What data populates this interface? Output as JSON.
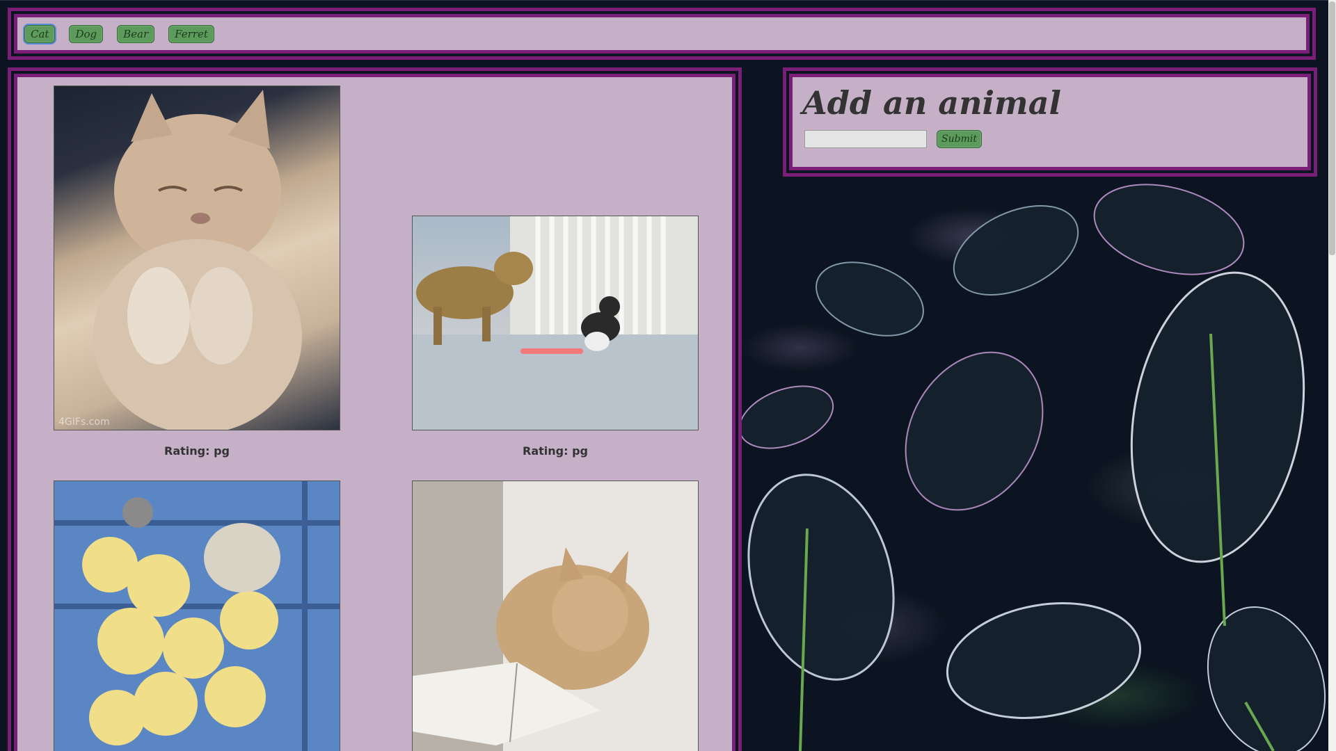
{
  "nav": {
    "buttons": [
      {
        "label": "Cat"
      },
      {
        "label": "Dog"
      },
      {
        "label": "Bear"
      },
      {
        "label": "Ferret"
      }
    ]
  },
  "gallery": {
    "items": [
      {
        "rating": "Rating: pg",
        "icon": "cat-gif-image"
      },
      {
        "rating": "Rating: pg",
        "icon": "dog-and-cat-gif-image"
      },
      {
        "rating": "",
        "icon": "cat-with-chicks-gif-image"
      },
      {
        "rating": "",
        "icon": "cat-with-book-gif-image"
      }
    ],
    "watermark": "4GIFs.com"
  },
  "form": {
    "title": "Add an animal",
    "input_value": "",
    "submit_label": "Submit"
  },
  "colors": {
    "panel_bg": "#c5b0c8",
    "panel_border": "#7a1f78",
    "button_bg": "#5d9b5d",
    "page_bg": "#0b1420"
  }
}
